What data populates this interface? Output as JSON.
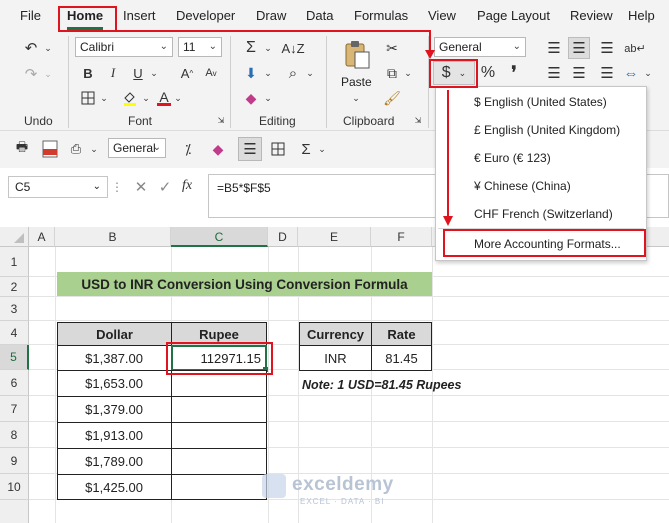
{
  "menu": {
    "tabs": [
      "File",
      "Home",
      "Insert",
      "Developer",
      "Draw",
      "Data",
      "Formulas",
      "View",
      "Page Layout",
      "Review",
      "Help"
    ]
  },
  "ribbon": {
    "font_name": "Calibri",
    "font_size": "11",
    "number_format": "General",
    "paste_label": "Paste",
    "groups": {
      "undo": "Undo",
      "font": "Font",
      "editing": "Editing",
      "clipboard": "Clipboard"
    }
  },
  "qat": {
    "number_format": "General"
  },
  "formula_bar": {
    "name_box": "C5",
    "fx": "fx",
    "formula": "=B5*$F$5"
  },
  "grid": {
    "columns": [
      "A",
      "B",
      "C",
      "D",
      "E",
      "F"
    ],
    "rows": [
      "1",
      "2",
      "3",
      "4",
      "5",
      "6",
      "7",
      "8",
      "9",
      "10"
    ]
  },
  "sheet": {
    "title": "USD to INR Conversion Using Conversion Formula",
    "table_headers": [
      "Dollar",
      "Rupee"
    ],
    "dollar_values": [
      "$1,387.00",
      "$1,653.00",
      "$1,379.00",
      "$1,913.00",
      "$1,789.00",
      "$1,425.00"
    ],
    "rupee_value": "112971.15",
    "rate_headers": [
      "Currency",
      "Rate"
    ],
    "currency": "INR",
    "rate": "81.45",
    "note": "Note: 1 USD=81.45 Rupees"
  },
  "accounting_dropdown": {
    "items": [
      "$ English (United States)",
      "£ English (United Kingdom)",
      "€ Euro (€ 123)",
      "¥ Chinese (China)",
      "CHF French (Switzerland)"
    ],
    "more": "More Accounting Formats..."
  },
  "watermark": {
    "name": "exceldemy",
    "tagline": "EXCEL · DATA · BI"
  },
  "colors": {
    "accent": "#217346",
    "highlight": "#e0141e",
    "title_fill": "#a9d08e"
  }
}
